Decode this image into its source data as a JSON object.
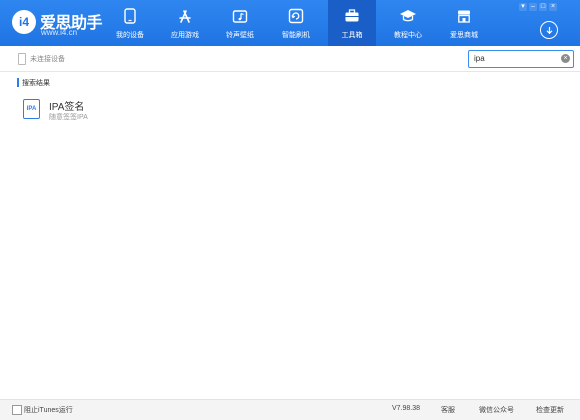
{
  "app": {
    "logo_icon": "i4",
    "name": "爱思助手",
    "url": "www.i4.cn"
  },
  "nav": [
    {
      "label": "我的设备",
      "icon": "phone-icon",
      "active": false
    },
    {
      "label": "应用游戏",
      "icon": "app-store-icon",
      "active": false
    },
    {
      "label": "铃声壁纸",
      "icon": "music-folder-icon",
      "active": false
    },
    {
      "label": "智能刷机",
      "icon": "flash-icon",
      "active": false
    },
    {
      "label": "工具箱",
      "icon": "toolbox-icon",
      "active": true
    },
    {
      "label": "教程中心",
      "icon": "graduation-cap-icon",
      "active": false
    },
    {
      "label": "爱思商城",
      "icon": "store-icon",
      "active": false
    }
  ],
  "subbar": {
    "device_status": "未连接设备",
    "search_value": "ipa"
  },
  "results": {
    "section_title": "搜索结果",
    "items": [
      {
        "title": "IPA签名",
        "subtitle": "随意签签IPA",
        "icon_text": "IPA"
      }
    ]
  },
  "footer": {
    "itunes_block_label": "阻止iTunes运行",
    "version": "V7.98.38",
    "feedback": "客服",
    "wechat": "微信公众号",
    "check_update": "检查更新"
  },
  "colors": {
    "topbar": "#2277e6",
    "active_tab": "#1a5fc8",
    "accent": "#2b7fe8"
  }
}
